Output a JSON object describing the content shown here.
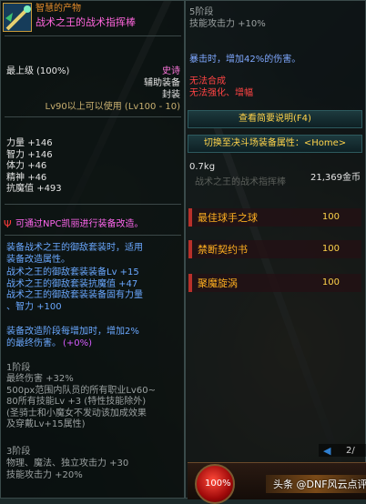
{
  "left": {
    "item_name_top": "智慧的产物",
    "item_name": "战术之王的战术指挥棒",
    "grade": "最上级",
    "grade_pct": "(100%)",
    "rarity": "史诗",
    "category": "辅助装备",
    "bind": "封装",
    "level_req": "Lv90以上可以使用 (Lv100 - 10)",
    "stats": [
      {
        "name": "力量",
        "value": "+146"
      },
      {
        "name": "智力",
        "value": "+146"
      },
      {
        "name": "体力",
        "value": "+46"
      },
      {
        "name": "精神",
        "value": "+46"
      },
      {
        "name": "抗魔值",
        "value": "+493"
      }
    ],
    "npc_line": "可通过NPC凯丽进行装备改造。",
    "set_desc_1": "装备战术之王的御敌套装时，适用",
    "set_desc_2": "装备改造属性。",
    "set_lines": [
      "战术之王的御敌套装装备Lv +15",
      "战术之王的御敌套装抗魔值 +47",
      "战术之王的御敌套装装备固有力量",
      "、智力 +100"
    ],
    "upgrade_1": "装备改造阶段每增加时，增加2%",
    "upgrade_2": "的最终伤害。",
    "upgrade_pct": "(+0%)",
    "stage1_title": "1阶段",
    "stage1_lines": [
      "最终伤害 +32%",
      "500px范围内队员的所有职业Lv60~",
      "80所有技能Lv +3 (特性技能除外)",
      "(圣骑士和小魔女不发动该加成效果",
      "及穿戴Lv+15属性)"
    ],
    "stage3_title": "3阶段",
    "stage3_lines": [
      "物理、魔法、独立攻击力 +30",
      "技能攻击力 +20%"
    ]
  },
  "right": {
    "stage5_title": "5阶段",
    "stage5_line": "技能攻击力 +10%",
    "crit_line": "暴击时，增加42%的伤害。",
    "no_synth": "无法合成",
    "no_reinforce": "无法强化、增幅",
    "view_desc": "查看简要说明(F4)",
    "switch_mode": "切换至决斗场装备属性：<Home>",
    "weight": "0.7kg",
    "price": "21,369金币",
    "faded_name": "战术之王的战术指挥棒",
    "set_items": [
      {
        "name": "最佳球手之球",
        "value": "100"
      },
      {
        "name": "禁断契约书",
        "value": "100"
      },
      {
        "name": "聚魔旋涡",
        "value": "100"
      }
    ],
    "page_indicator": "2/",
    "hp_label": "100%",
    "watermark": "头条 @DNF风云点评说"
  }
}
